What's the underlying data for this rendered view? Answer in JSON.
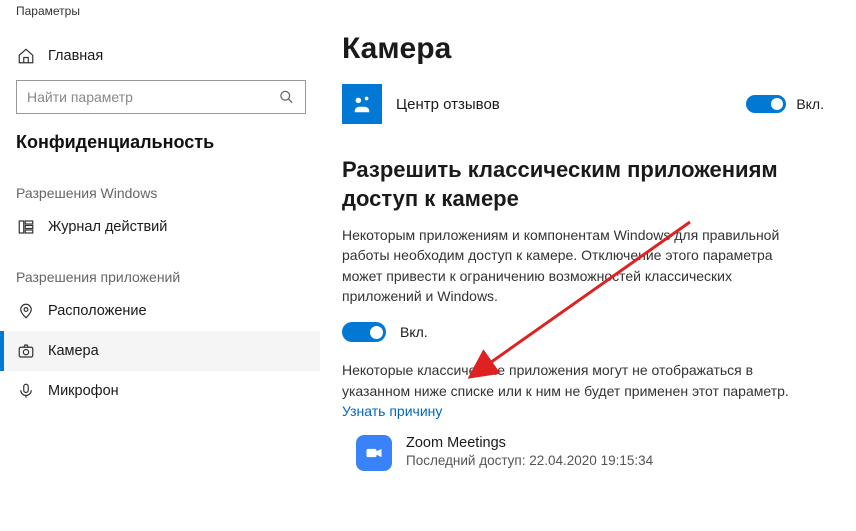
{
  "window": {
    "title": "Параметры"
  },
  "sidebar": {
    "home": "Главная",
    "search_placeholder": "Найти параметр",
    "privacy": "Конфиденциальность",
    "cat_windows": "Разрешения Windows",
    "activity": "Журнал действий",
    "cat_apps": "Разрешения приложений",
    "location": "Расположение",
    "camera": "Камера",
    "microphone": "Микрофон"
  },
  "main": {
    "title": "Камера",
    "app1": {
      "name": "Центр отзывов",
      "toggle": "Вкл."
    },
    "section_title": "Разрешить классическим приложениям доступ к камере",
    "desc": "Некоторым приложениям и компонентам Windows для правильной работы необходим доступ к камере. Отключение этого параметра может привести к ограничению возможностей классических приложений и Windows.",
    "toggle2": "Вкл.",
    "note": "Некоторые классические приложения могут не отображаться в указанном ниже списке или к ним не будет применен этот параметр. ",
    "why_link": "Узнать причину",
    "desktop_app": {
      "name": "Zoom Meetings",
      "last_access": "Последний доступ: 22.04.2020 19:15:34"
    }
  }
}
